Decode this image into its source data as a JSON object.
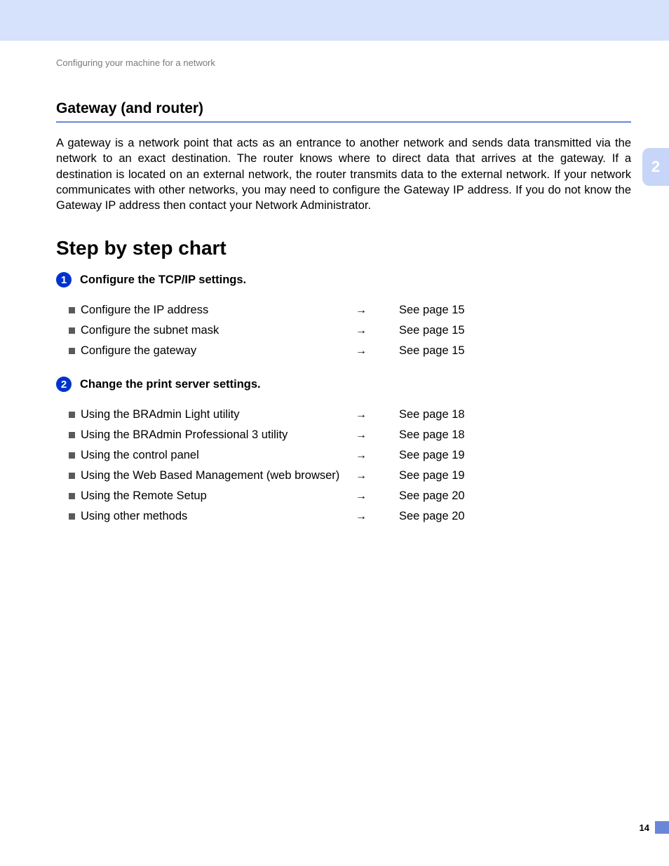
{
  "breadcrumb": "Configuring your machine for a network",
  "section": {
    "title": "Gateway (and router)",
    "body": "A gateway is a network point that acts as an entrance to another network and sends data transmitted via the network to an exact destination. The router knows where to direct data that arrives at the gateway. If a destination is located on an external network, the router transmits data to the external network. If your network communicates with other networks, you may need to configure the Gateway IP address. If you do not know the Gateway IP address then contact your Network Administrator."
  },
  "chart_heading": "Step by step chart",
  "steps": [
    {
      "num": "1",
      "title": "Configure the TCP/IP settings.",
      "items": [
        {
          "label": "Configure the IP address",
          "arrow": "→",
          "ref": "See page 15"
        },
        {
          "label": "Configure the subnet mask",
          "arrow": "→",
          "ref": "See page 15"
        },
        {
          "label": "Configure the gateway",
          "arrow": "→",
          "ref": "See page 15"
        }
      ]
    },
    {
      "num": "2",
      "title": "Change the print server settings.",
      "items": [
        {
          "label": "Using the BRAdmin Light utility",
          "arrow": "→",
          "ref": "See page 18"
        },
        {
          "label": "Using the BRAdmin Professional 3 utility",
          "arrow": "→",
          "ref": "See page 18"
        },
        {
          "label": "Using the control panel",
          "arrow": "→",
          "ref": "See page 19"
        },
        {
          "label": "Using the Web Based Management (web browser)",
          "arrow": "→",
          "ref": "See page 19"
        },
        {
          "label": "Using the Remote Setup",
          "arrow": "→",
          "ref": "See page 20"
        },
        {
          "label": "Using other methods",
          "arrow": "→",
          "ref": "See page 20"
        }
      ]
    }
  ],
  "side_tab": "2",
  "page_number": "14"
}
